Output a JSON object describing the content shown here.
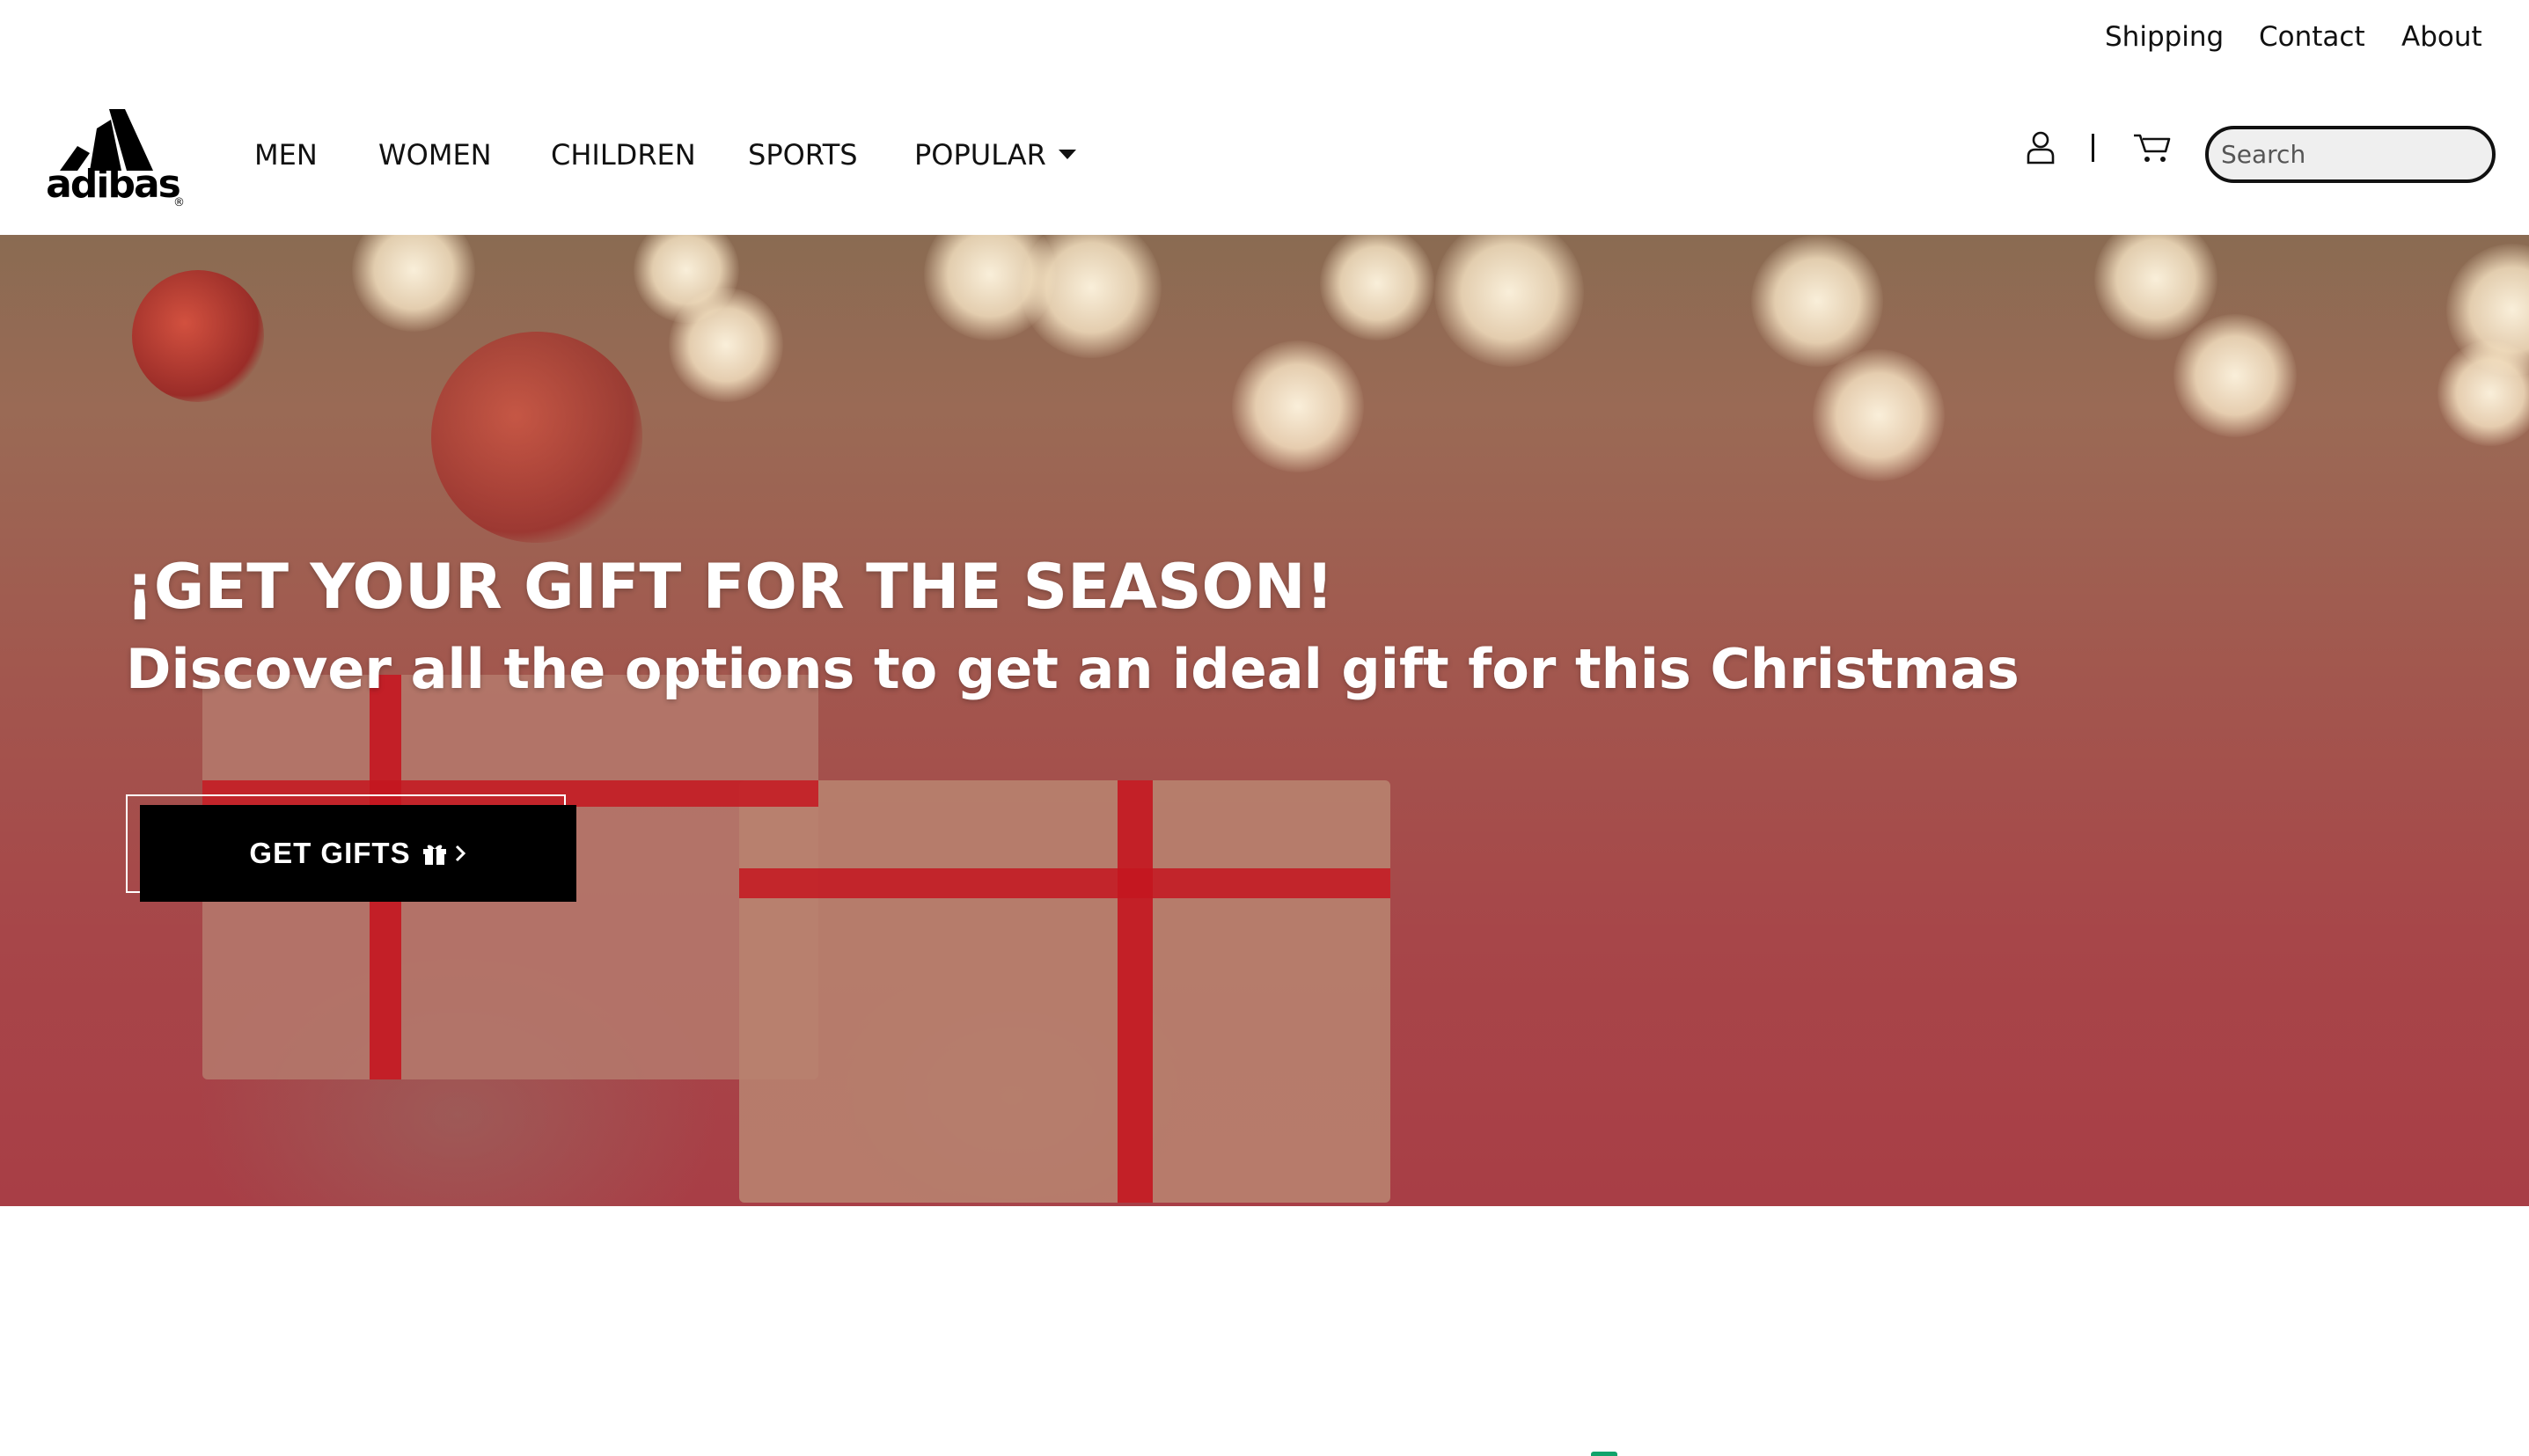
{
  "utility_nav": {
    "shipping": "Shipping",
    "contact": "Contact",
    "about": "About"
  },
  "brand": {
    "logo_text": "adibas",
    "logo_mark": "®"
  },
  "main_nav": {
    "items": [
      {
        "label": "MEN"
      },
      {
        "label": "WOMEN"
      },
      {
        "label": "CHILDREN"
      },
      {
        "label": "SPORTS"
      },
      {
        "label": "POPULAR"
      }
    ]
  },
  "header_icons": {
    "account": "user-icon",
    "separator": "|",
    "cart": "cart-icon"
  },
  "search": {
    "placeholder": "Search",
    "value": ""
  },
  "hero": {
    "title": "¡GET YOUR GIFT FOR THE SEASON!",
    "subtitle": "Discover all the options to get an ideal gift for this Christmas",
    "cta_label": "GET GIFTS",
    "cta_icons": [
      "gift-icon",
      "chevron-right-icon"
    ]
  },
  "colors": {
    "primary_text": "#111111",
    "hero_overlay": "#a83e46",
    "cta_background": "#000000",
    "cta_text": "#ffffff",
    "accent_green": "#12a36b"
  }
}
